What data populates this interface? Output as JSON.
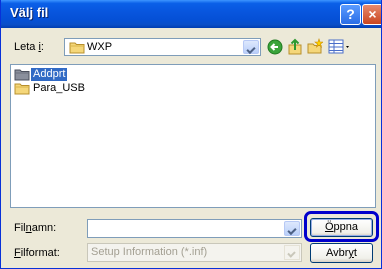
{
  "window": {
    "title": "Välj fil",
    "help_label": "?",
    "close_label": "×"
  },
  "toolbar": {
    "lookin_pre": "Leta ",
    "lookin_key": "i",
    "lookin_post": ":",
    "lookin_value": "WXP"
  },
  "files": [
    {
      "name": "Addprt",
      "selected": true
    },
    {
      "name": "Para_USB",
      "selected": false
    }
  ],
  "filename": {
    "pre": "Fil",
    "key": "n",
    "post": "amn:",
    "value": ""
  },
  "filetype": {
    "key": "F",
    "post": "ilformat:",
    "value": "Setup Information (*.inf)"
  },
  "buttons": {
    "open_key": "Ö",
    "open_post": "ppna",
    "cancel_pre": "Avbr",
    "cancel_key": "y",
    "cancel_post": "t"
  },
  "colors": {
    "titlebar": "#0855dd",
    "dialog_bg": "#ece9d8",
    "selection": "#316ac5",
    "highlight_ring": "#0000cc"
  }
}
